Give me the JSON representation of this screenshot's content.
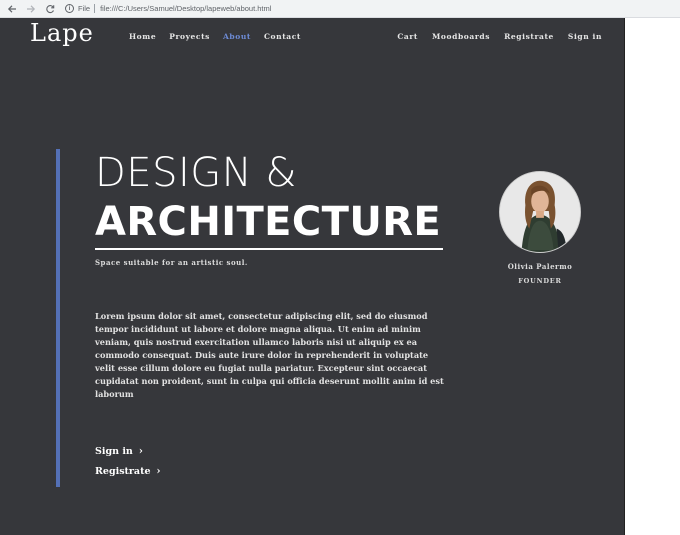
{
  "browser": {
    "scheme": "File",
    "url": "file:///C:/Users/Samuel/Desktop/lapeweb/about.html"
  },
  "site": {
    "logo": "Lape",
    "nav_left": [
      "Home",
      "Proyects",
      "About",
      "Contact"
    ],
    "nav_right": [
      "Cart",
      "Moodboards",
      "Registrate",
      "Sign in"
    ],
    "active_nav": "About",
    "accent_color": "#5470b6",
    "background_color": "#36373b"
  },
  "hero": {
    "line1_thin": "DESIGN",
    "line1_amp": "&",
    "line2_bold": "ARCHITECTURE",
    "tagline": "Space suitable for an artistic soul."
  },
  "founder": {
    "name": "Olivia Palermo",
    "role": "FOUNDER"
  },
  "body": {
    "paragraph": "Lorem ipsum dolor sit amet, consectetur adipiscing elit, sed do eiusmod tempor incididunt ut labore et dolore magna aliqua. Ut enim ad minim veniam, quis nostrud exercitation ullamco laboris nisi ut aliquip ex ea commodo consequat. Duis aute irure dolor in reprehenderit in voluptate velit esse cillum dolore eu fugiat nulla pariatur. Excepteur sint occaecat cupidatat non proident, sunt in culpa qui officia deserunt mollit anim id est laborum"
  },
  "actions": {
    "sign_in": "Sign in",
    "registrate": "Registrate",
    "chevron": "›"
  }
}
